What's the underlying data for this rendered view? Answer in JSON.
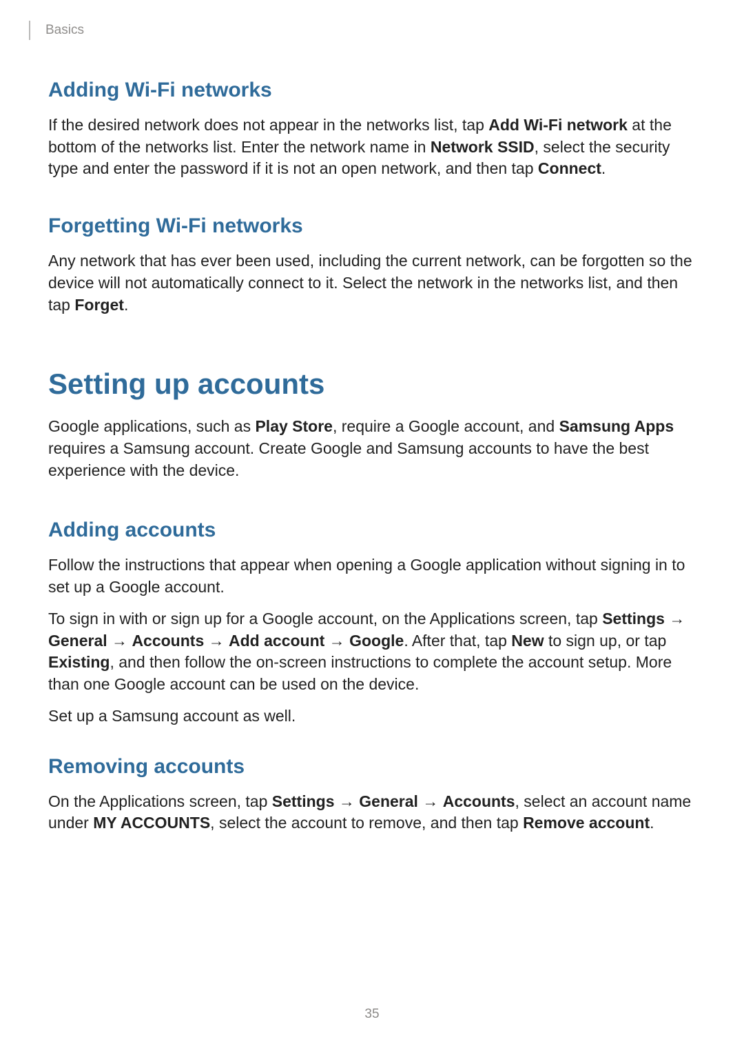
{
  "breadcrumb": "Basics",
  "page_number": "35",
  "sections": {
    "adding_wifi": {
      "title": "Adding Wi-Fi networks",
      "p1_a": "If the desired network does not appear in the networks list, tap ",
      "p1_b_bold": "Add Wi-Fi network",
      "p1_c": " at the bottom of the networks list. Enter the network name in ",
      "p1_d_bold": "Network SSID",
      "p1_e": ", select the security type and enter the password if it is not an open network, and then tap ",
      "p1_f_bold": "Connect",
      "p1_g": "."
    },
    "forgetting_wifi": {
      "title": "Forgetting Wi-Fi networks",
      "p1_a": "Any network that has ever been used, including the current network, can be forgotten so the device will not automatically connect to it. Select the network in the networks list, and then tap ",
      "p1_b_bold": "Forget",
      "p1_c": "."
    },
    "setting_up": {
      "title": "Setting up accounts",
      "p1_a": "Google applications, such as ",
      "p1_b_bold": "Play Store",
      "p1_c": ", require a Google account, and ",
      "p1_d_bold": "Samsung Apps",
      "p1_e": " requires a Samsung account. Create Google and Samsung accounts to have the best experience with the device."
    },
    "adding_accounts": {
      "title": "Adding accounts",
      "p1": "Follow the instructions that appear when opening a Google application without signing in to set up a Google account.",
      "p2_a": "To sign in with or sign up for a Google account, on the Applications screen, tap ",
      "p2_b_bold": "Settings",
      "p2_c": " → ",
      "p2_d_bold": "General",
      "p2_e": " → ",
      "p2_f_bold": "Accounts",
      "p2_g": " → ",
      "p2_h_bold": "Add account",
      "p2_i": " → ",
      "p2_j_bold": "Google",
      "p2_k": ". After that, tap ",
      "p2_l_bold": "New",
      "p2_m": " to sign up, or tap ",
      "p2_n_bold": "Existing",
      "p2_o": ", and then follow the on-screen instructions to complete the account setup. More than one Google account can be used on the device.",
      "p3": "Set up a Samsung account as well."
    },
    "removing_accounts": {
      "title": "Removing accounts",
      "p1_a": "On the Applications screen, tap ",
      "p1_b_bold": "Settings",
      "p1_c": " → ",
      "p1_d_bold": "General",
      "p1_e": " → ",
      "p1_f_bold": "Accounts",
      "p1_g": ", select an account name under ",
      "p1_h_bold": "MY ACCOUNTS",
      "p1_i": ", select the account to remove, and then tap ",
      "p1_j_bold": "Remove account",
      "p1_k": "."
    }
  }
}
